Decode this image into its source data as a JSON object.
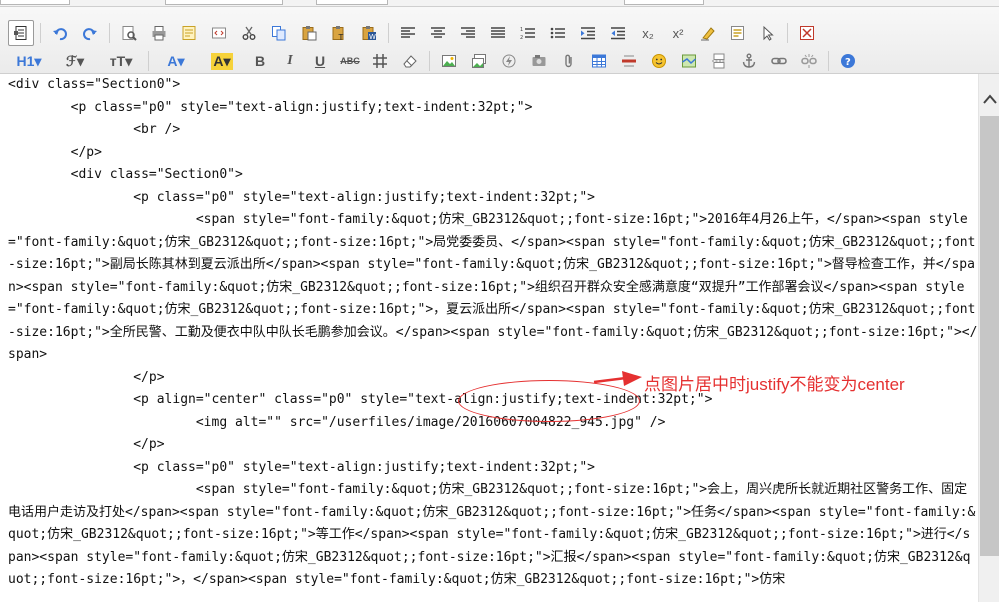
{
  "colors": {
    "accent_red": "#e53030",
    "toolbar_bg": "#ececec",
    "icon_blue": "#3c78d8"
  },
  "toolbar": {
    "row1": [
      {
        "icon": "source-icon",
        "active": true
      },
      {
        "sep": true
      },
      {
        "icon": "undo-icon"
      },
      {
        "icon": "redo-icon"
      },
      {
        "sep": true
      },
      {
        "icon": "preview-icon"
      },
      {
        "icon": "print-icon"
      },
      {
        "icon": "template-icon"
      },
      {
        "icon": "code-icon"
      },
      {
        "icon": "cut-icon"
      },
      {
        "icon": "copy-icon"
      },
      {
        "icon": "paste-icon"
      },
      {
        "icon": "paste-plain-icon"
      },
      {
        "icon": "paste-word-icon"
      },
      {
        "sep": true
      },
      {
        "icon": "align-left-icon"
      },
      {
        "icon": "align-center-icon"
      },
      {
        "icon": "align-right-icon"
      },
      {
        "icon": "align-justify-icon"
      },
      {
        "icon": "ordered-list-icon"
      },
      {
        "icon": "bullet-list-icon"
      },
      {
        "icon": "indent-icon"
      },
      {
        "icon": "outdent-icon"
      },
      {
        "icon": "subscript-icon",
        "text": "x₂"
      },
      {
        "icon": "superscript-icon",
        "text": "x²"
      },
      {
        "icon": "clear-format-icon"
      },
      {
        "icon": "select-all-icon"
      },
      {
        "icon": "cursor-icon"
      },
      {
        "sep": true
      },
      {
        "icon": "fullscreen-icon"
      }
    ],
    "row2": [
      {
        "icon": "heading-icon",
        "text": "H1▾",
        "wide": true
      },
      {
        "icon": "font-family-icon",
        "text": "ℱ▾",
        "wide": true
      },
      {
        "icon": "font-size-icon",
        "text": "тT▾",
        "wide": true
      },
      {
        "sep": true
      },
      {
        "icon": "font-color-icon",
        "text": "A▾",
        "wide": true
      },
      {
        "icon": "highlight-icon",
        "text": "A▾",
        "wide": true
      },
      {
        "icon": "bold-icon",
        "text": "B"
      },
      {
        "icon": "italic-icon",
        "text": "I"
      },
      {
        "icon": "underline-icon",
        "text": "U"
      },
      {
        "icon": "strikethrough-icon",
        "text": "ABC"
      },
      {
        "icon": "table-grid-icon"
      },
      {
        "icon": "eraser-icon"
      },
      {
        "sep": true
      },
      {
        "icon": "image-icon"
      },
      {
        "icon": "multi-image-icon"
      },
      {
        "icon": "flash-icon"
      },
      {
        "icon": "media-icon"
      },
      {
        "icon": "attachment-icon"
      },
      {
        "icon": "table-icon"
      },
      {
        "icon": "hr-icon"
      },
      {
        "icon": "emoticon-icon"
      },
      {
        "icon": "map-icon"
      },
      {
        "icon": "page-break-icon"
      },
      {
        "icon": "anchor-icon"
      },
      {
        "icon": "link-icon"
      },
      {
        "icon": "unlink-icon"
      },
      {
        "sep": true
      },
      {
        "icon": "help-icon"
      }
    ]
  },
  "source_lines": [
    "<div class=\"Section0\">",
    "        <p class=\"p0\" style=\"text-align:justify;text-indent:32pt;\">",
    "                <br />",
    "        </p>",
    "        <div class=\"Section0\">",
    "                <p class=\"p0\" style=\"text-align:justify;text-indent:32pt;\">",
    "                        <span style=\"font-family:&quot;仿宋_GB2312&quot;;font-size:16pt;\">2016年4月26上午，</span><span style=\"font-family:&quot;仿宋_GB2312&quot;;font-size:16pt;\">局党委委员、</span><span style=\"font-family:&quot;仿宋_GB2312&quot;;font-size:16pt;\">副局长陈其林到夏云派出所</span><span style=\"font-family:&quot;仿宋_GB2312&quot;;font-size:16pt;\">督导检查工作，并</span><span style=\"font-family:&quot;仿宋_GB2312&quot;;font-size:16pt;\">组织召开群众安全感满意度“双提升”工作部署会议</span><span style=\"font-family:&quot;仿宋_GB2312&quot;;font-size:16pt;\">，夏云派出所</span><span style=\"font-family:&quot;仿宋_GB2312&quot;;font-size:16pt;\">全所民警、工勤及便衣中队中队长毛鹏参加会议。</span><span style=\"font-family:&quot;仿宋_GB2312&quot;;font-size:16pt;\"></span>",
    "                </p>",
    "                <p align=\"center\" class=\"p0\" style=\"text-align:justify;text-indent:32pt;\">",
    "                        <img alt=\"\" src=\"/userfiles/image/20160607004822_945.jpg\" />",
    "                </p>",
    "                <p class=\"p0\" style=\"text-align:justify;text-indent:32pt;\">",
    "                        <span style=\"font-family:&quot;仿宋_GB2312&quot;;font-size:16pt;\">会上，周兴虎所长就近期社区警务工作、固定电话用户走访及打处</span><span style=\"font-family:&quot;仿宋_GB2312&quot;;font-size:16pt;\">任务</span><span style=\"font-family:&quot;仿宋_GB2312&quot;;font-size:16pt;\">等工作</span><span style=\"font-family:&quot;仿宋_GB2312&quot;;font-size:16pt;\">进行</span><span style=\"font-family:&quot;仿宋_GB2312&quot;;font-size:16pt;\">汇报</span><span style=\"font-family:&quot;仿宋_GB2312&quot;;font-size:16pt;\">，</span><span style=\"font-family:&quot;仿宋_GB2312&quot;;font-size:16pt;\">仿宋"
  ],
  "annotation": {
    "text": "点图片居中时justify不能变为center"
  }
}
